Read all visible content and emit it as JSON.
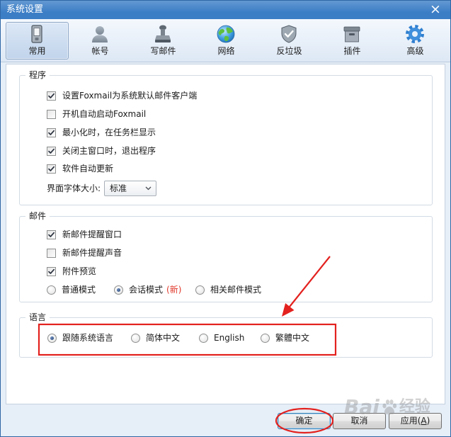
{
  "colors": {
    "titlebar": "#3b7ec6",
    "new_badge": "#e0382b",
    "annotation": "#e3211e"
  },
  "window": {
    "title": "系统设置",
    "close_label": "×"
  },
  "toolbar": {
    "tabs": [
      {
        "label": "常用",
        "icon": "general-icon",
        "selected": true
      },
      {
        "label": "帐号",
        "icon": "account-icon",
        "selected": false
      },
      {
        "label": "写邮件",
        "icon": "compose-icon",
        "selected": false
      },
      {
        "label": "网络",
        "icon": "network-globe-icon",
        "selected": false
      },
      {
        "label": "反垃圾",
        "icon": "antispam-shield-icon",
        "selected": false
      },
      {
        "label": "插件",
        "icon": "plugin-box-icon",
        "selected": false
      },
      {
        "label": "高级",
        "icon": "advanced-gear-icon",
        "selected": false
      }
    ]
  },
  "program": {
    "title": "程序",
    "options": [
      {
        "label": "设置Foxmail为系统默认邮件客户端",
        "checked": true
      },
      {
        "label": "开机自动启动Foxmail",
        "checked": false
      },
      {
        "label": "最小化时，在任务栏显示",
        "checked": true
      },
      {
        "label": "关闭主窗口时，退出程序",
        "checked": true
      },
      {
        "label": "软件自动更新",
        "checked": true
      }
    ],
    "font_size": {
      "label": "界面字体大小:",
      "value": "标准"
    }
  },
  "mail": {
    "title": "邮件",
    "options": [
      {
        "label": "新邮件提醒窗口",
        "checked": true
      },
      {
        "label": "新邮件提醒声音",
        "checked": false
      },
      {
        "label": "附件预览",
        "checked": true
      }
    ],
    "view_modes": [
      {
        "label": "普通模式",
        "selected": false
      },
      {
        "label": "会话模式",
        "selected": true,
        "badge": "(新)"
      },
      {
        "label": "相关邮件模式",
        "selected": false
      }
    ]
  },
  "language": {
    "title": "语言",
    "options": [
      {
        "label": "跟随系统语言",
        "selected": true
      },
      {
        "label": "简体中文",
        "selected": false
      },
      {
        "label": "English",
        "selected": false
      },
      {
        "label": "繁體中文",
        "selected": false
      }
    ]
  },
  "buttons": {
    "ok": "确定",
    "cancel": "取消",
    "apply": "应用(A)"
  },
  "watermark": {
    "brand": "Bai",
    "product": "经验",
    "icon": "paw-icon"
  }
}
